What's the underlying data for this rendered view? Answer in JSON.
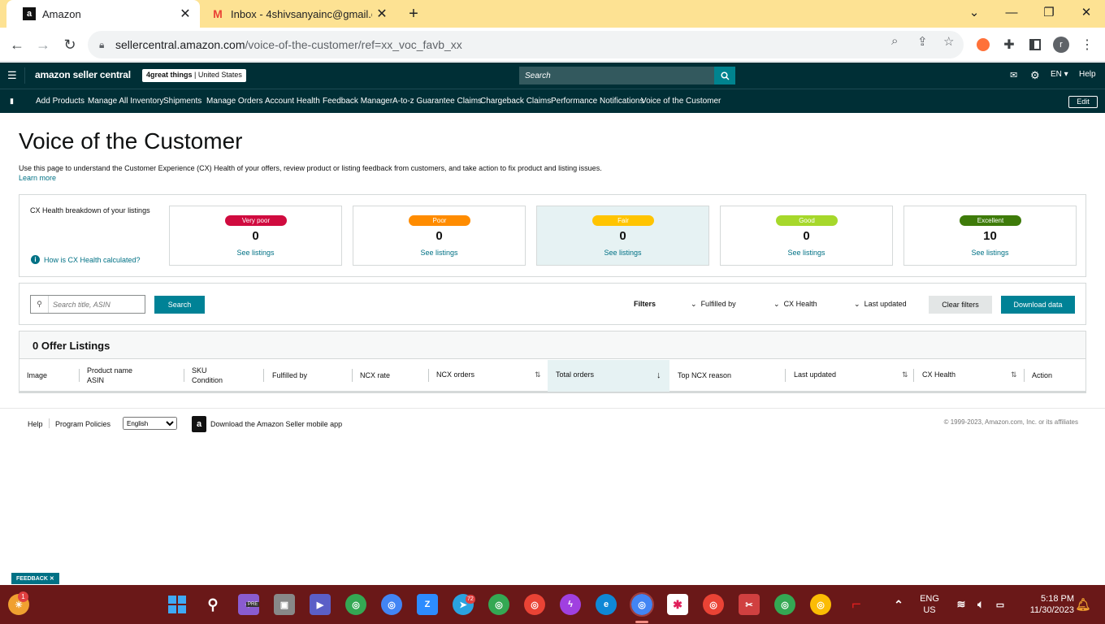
{
  "browser": {
    "tabs": [
      {
        "title": "Amazon",
        "favicon": "a",
        "active": true
      },
      {
        "title": "Inbox - 4shivsanyainc@gmail.co",
        "favicon": "M",
        "active": false
      }
    ],
    "new_tab": "+",
    "url_host": "sellercentral.amazon.com",
    "url_path": "/voice-of-the-customer/ref=xx_voc_favb_xx",
    "profile_initial": "r"
  },
  "header": {
    "logo": "amazon seller central",
    "store_name": "4great things",
    "store_region": "United States",
    "search_placeholder": "Search",
    "language": "EN",
    "help": "Help"
  },
  "nav": {
    "items": [
      "Add Products",
      "Manage All Inventory",
      "Shipments",
      "Manage Orders",
      "Account Health",
      "Feedback Manager",
      "A-to-z Guarantee Claims",
      "Chargeback Claims",
      "Performance Notifications",
      "Voice of the Customer"
    ],
    "edit": "Edit"
  },
  "main": {
    "title": "Voice of the Customer",
    "description": "Use this page to understand the Customer Experience (CX) Health of your offers, review product or listing feedback from customers, and take action to fix product and listing issues.",
    "learn_more": "Learn more",
    "cx_label": "CX Health breakdown of your listings",
    "cx_how": "How is CX Health calculated?",
    "cx_cards": [
      {
        "label": "Very poor",
        "count": "0",
        "link": "See listings",
        "color": "#d00b3f"
      },
      {
        "label": "Poor",
        "count": "0",
        "link": "See listings",
        "color": "#ff8c00"
      },
      {
        "label": "Fair",
        "count": "0",
        "link": "See listings",
        "color": "#ffc400"
      },
      {
        "label": "Good",
        "count": "0",
        "link": "See listings",
        "color": "#a6d82b"
      },
      {
        "label": "Excellent",
        "count": "10",
        "link": "See listings",
        "color": "#3e7b0a"
      }
    ],
    "search_placeholder": "Search title, ASIN",
    "search_button": "Search",
    "filters_label": "Filters",
    "filter_fulfilled": "Fulfilled by",
    "filter_cx": "CX Health",
    "filter_updated": "Last updated",
    "clear_filters": "Clear filters",
    "download": "Download data",
    "table_title": "0 Offer Listings",
    "columns": {
      "image": "Image",
      "product_name": "Product name",
      "asin": "ASIN",
      "sku": "SKU",
      "condition": "Condition",
      "fulfilled_by": "Fulfilled by",
      "ncx_rate": "NCX rate",
      "ncx_orders": "NCX orders",
      "total_orders": "Total orders",
      "top_ncx_reason": "Top NCX reason",
      "last_updated": "Last updated",
      "cx_health": "CX Health",
      "action": "Action"
    }
  },
  "footer": {
    "help": "Help",
    "program_policies": "Program Policies",
    "language": "English",
    "app_text": "Download the Amazon Seller mobile app",
    "copyright": "© 1999-2023, Amazon.com, Inc. or its affiliates"
  },
  "feedback": "FEEDBACK ✕",
  "taskbar": {
    "lang_line1": "ENG",
    "lang_line2": "US",
    "time": "5:18 PM",
    "date": "11/30/2023",
    "notif_badge": "1",
    "telegram_badge": "72",
    "pre_label": "PRE"
  },
  "colors": {
    "header_bg": "#002f36",
    "accent": "#008296",
    "link": "#007185",
    "tab_bar": "#fde293",
    "taskbar": "#6a1818"
  }
}
